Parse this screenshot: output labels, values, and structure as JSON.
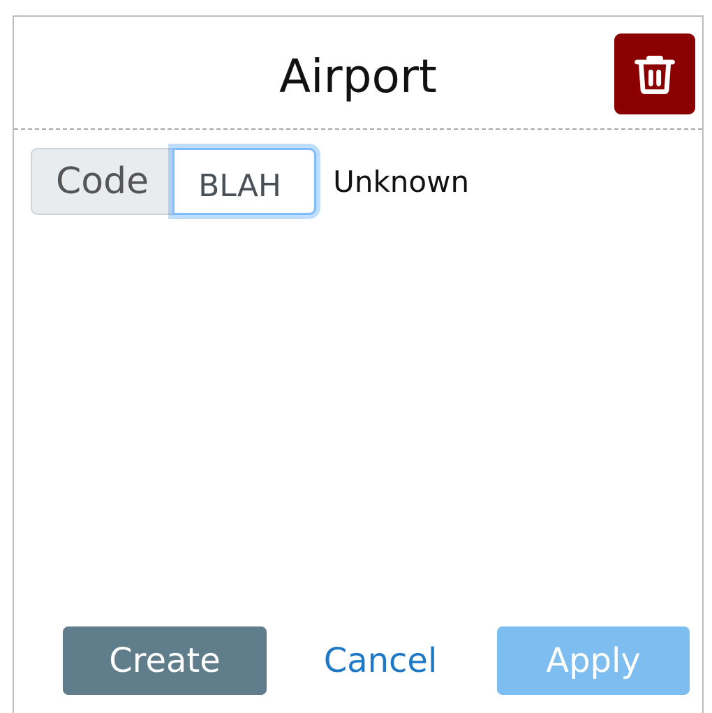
{
  "dialog": {
    "title": "Airport",
    "delete_icon": "trash-icon",
    "delete_color": "#8b0000"
  },
  "form": {
    "code_label": "Code",
    "code_value": "BLAH",
    "code_status": "Unknown"
  },
  "footer": {
    "create_label": "Create",
    "cancel_label": "Cancel",
    "apply_label": "Apply"
  },
  "colors": {
    "create": "#607d8b",
    "apply_disabled": "#7dbdf0",
    "cancel_link": "#1e78c8"
  }
}
